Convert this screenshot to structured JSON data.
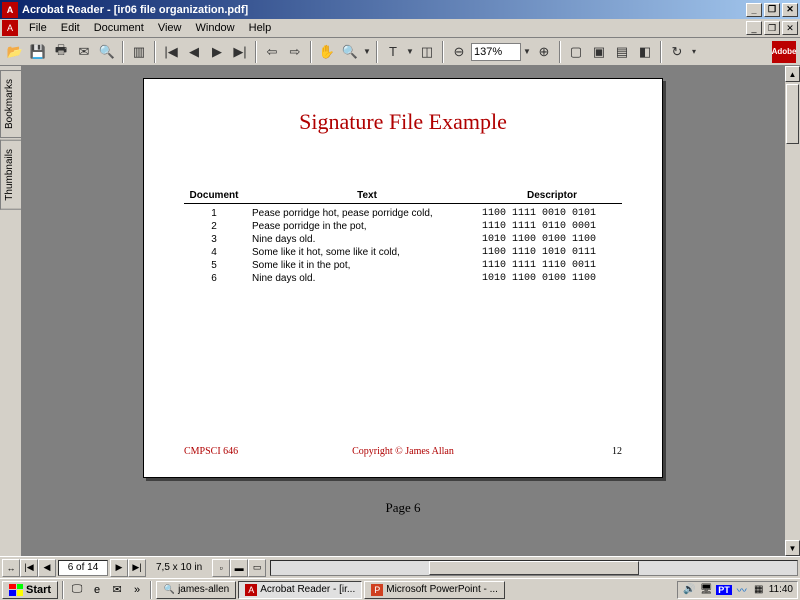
{
  "window": {
    "title": "Acrobat Reader - [ir06 file organization.pdf]"
  },
  "menu": {
    "file": "File",
    "edit": "Edit",
    "document": "Document",
    "view": "View",
    "window": "Window",
    "help": "Help"
  },
  "toolbar": {
    "zoom_value": "137%",
    "adobe": "Adobe"
  },
  "sidebar": {
    "bookmarks": "Bookmarks",
    "thumbnails": "Thumbnails"
  },
  "document": {
    "title": "Signature File Example",
    "headers": {
      "doc": "Document",
      "text": "Text",
      "desc": "Descriptor"
    },
    "rows": [
      {
        "n": "1",
        "text": "Pease porridge hot, pease porridge cold,",
        "desc": "1100 1111 0010 0101"
      },
      {
        "n": "2",
        "text": "Pease porridge in the pot,",
        "desc": "1110 1111 0110 0001"
      },
      {
        "n": "3",
        "text": "Nine days old.",
        "desc": "1010 1100 0100 1100"
      },
      {
        "n": "4",
        "text": "Some like it hot, some like it cold,",
        "desc": "1100 1110 1010 0111"
      },
      {
        "n": "5",
        "text": "Some like it in the pot,",
        "desc": "1110 1111 1110 0011"
      },
      {
        "n": "6",
        "text": "Nine days old.",
        "desc": "1010 1100 0100 1100"
      }
    ],
    "footer_left": "CMPSCI 646",
    "footer_center": "Copyright © James Allan",
    "footer_right": "12",
    "page_label": "Page 6"
  },
  "status": {
    "page_of": "6 of 14",
    "dimensions": "7,5 x 10 in"
  },
  "taskbar": {
    "start": "Start",
    "item1": "james-allen",
    "item2": "Acrobat Reader - [ir...",
    "item3": "Microsoft PowerPoint - ...",
    "lang": "PT",
    "clock": "11:40"
  }
}
